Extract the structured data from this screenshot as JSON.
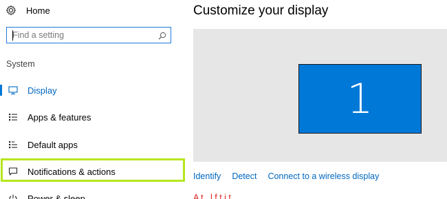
{
  "sidebar": {
    "home_label": "Home",
    "search": {
      "placeholder": "Find a setting",
      "value": ""
    },
    "section_label": "System",
    "items": [
      {
        "label": "Display",
        "icon": "monitor-icon",
        "active": true
      },
      {
        "label": "Apps & features",
        "icon": "apps-list-icon",
        "active": false
      },
      {
        "label": "Default apps",
        "icon": "default-apps-icon",
        "active": false
      },
      {
        "label": "Notifications & actions",
        "icon": "message-icon",
        "active": false
      },
      {
        "label": "Power & sleep",
        "icon": "power-icon",
        "active": false
      }
    ],
    "highlight_color": "#b5e61d"
  },
  "main": {
    "title": "Customize your display",
    "monitor_number": "1",
    "links": {
      "identify": "Identify",
      "detect": "Detect",
      "wireless": "Connect to a wireless display"
    },
    "cut_off_text": "A  t  ,  l  f  t  i  t"
  },
  "colors": {
    "accent": "#0078d7",
    "link": "#0067c0",
    "preview_bg": "#e6e6e6",
    "red_text": "#d9231f"
  }
}
